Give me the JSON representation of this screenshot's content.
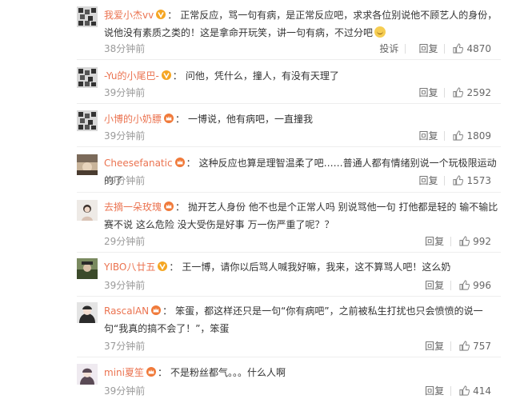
{
  "comments": [
    {
      "username": "我爱小杰vv",
      "badge": "vip-v-badge",
      "text": "正常反应，骂一句有病，是正常反应吧，求求各位别说他不顾艺人的身份，说他没有素质之类的！这是拿命开玩笑，讲一句有病，不过分吧",
      "emoji": "sad-emoji",
      "time": "38分钟前",
      "report": "投诉",
      "reply": "回复",
      "likes": "4870"
    },
    {
      "username": "-Yu的小尾巴-",
      "badge": "vip-v-badge",
      "text": "问他，凭什么，撞人，有没有天理了",
      "time": "39分钟前",
      "reply": "回复",
      "likes": "2592"
    },
    {
      "username": "小博的小奶膘",
      "badge": "fan-crown-badge",
      "text": "一博说，他有病吧，一直撞我",
      "time": "39分钟前",
      "reply": "回复",
      "likes": "1809"
    },
    {
      "username": "Cheesefanatic",
      "badge": "fan-crown-badge",
      "text": "这种反应也算是理智温柔了吧……普通人都有情绪别说一个玩极限运动的了",
      "time": "39分钟前",
      "reply": "回复",
      "likes": "1573"
    },
    {
      "username": "去摘一朵玫瑰",
      "badge": "fan-crown-badge",
      "text": "抛开艺人身份 他不也是个正常人吗 别说骂他一句 打他都是轻的 输不输比赛不说 这么危险 没大受伤是好事 万一伤严重了呢？？",
      "time": "29分钟前",
      "reply": "回复",
      "likes": "992"
    },
    {
      "username": "YIBO八廿五",
      "badge": "vip-v-badge",
      "text": "王一博，请你以后骂人喊我好嘛，我来，这不算骂人吧！这么奶",
      "time": "39分钟前",
      "reply": "回复",
      "likes": "996"
    },
    {
      "username": "RascalAN",
      "badge": "fan-crown-badge",
      "text": "笨蛋，都这样还只是一句“你有病吧”，之前被私生打扰也只会愤愤的说一句“我真的搞不会了！”，笨蛋",
      "time": "37分钟前",
      "reply": "回复",
      "likes": "757"
    },
    {
      "username": "mini夏笙",
      "badge": "fan-crown-badge",
      "text": "不是粉丝都气。。。什么人啊",
      "time": "39分钟前",
      "reply": "回复",
      "likes": "414"
    }
  ],
  "colors": {
    "username": "#eb7350",
    "text": "#333333",
    "time": "#9a9a9a",
    "badge_vip": "#f5a623",
    "badge_crown": "#f07a3a"
  }
}
